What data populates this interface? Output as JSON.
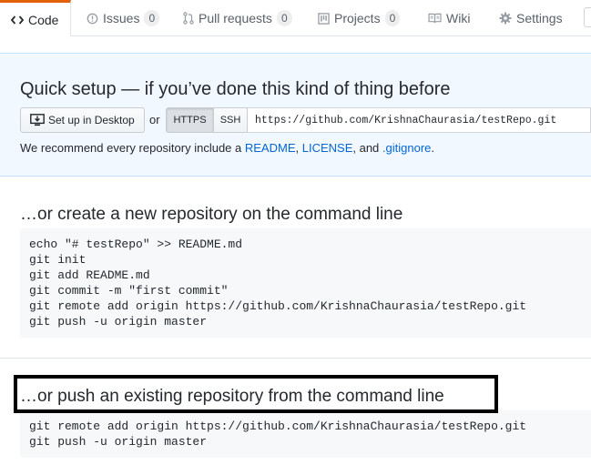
{
  "tabs": [
    {
      "label": "Code",
      "icon": "code-icon",
      "selected": true
    },
    {
      "label": "Issues",
      "icon": "issue-icon",
      "count": "0"
    },
    {
      "label": "Pull requests",
      "icon": "pull-request-icon",
      "count": "0"
    },
    {
      "label": "Projects",
      "icon": "project-icon",
      "count": "0"
    },
    {
      "label": "Wiki",
      "icon": "book-icon"
    },
    {
      "label": "Settings",
      "icon": "gear-icon"
    }
  ],
  "quick_setup": {
    "title": "Quick setup — if you’ve done this kind of thing before",
    "desktop_button": "Set up in Desktop",
    "or": "or",
    "https": "HTTPS",
    "ssh": "SSH",
    "url": "https://github.com/KrishnaChaurasia/testRepo.git",
    "recommend_prefix": "We recommend every repository include a ",
    "readme": "README",
    "comma": ", ",
    "license": "LICENSE",
    "and": ", and ",
    "gitignore": ".gitignore",
    "period": "."
  },
  "new_repo": {
    "title": "…or create a new repository on the command line",
    "code": "echo \"# testRepo\" >> README.md\ngit init\ngit add README.md\ngit commit -m \"first commit\"\ngit remote add origin https://github.com/KrishnaChaurasia/testRepo.git\ngit push -u origin master"
  },
  "existing_repo": {
    "title": "…or push an existing repository from the command line",
    "code": "git remote add origin https://github.com/KrishnaChaurasia/testRepo.git\ngit push -u origin master"
  },
  "colors": {
    "accent_tab": "#e36209",
    "link": "#0366d6",
    "quick_bg": "#f1f8ff",
    "code_bg": "#f6f8fa",
    "highlight": "#000000"
  }
}
